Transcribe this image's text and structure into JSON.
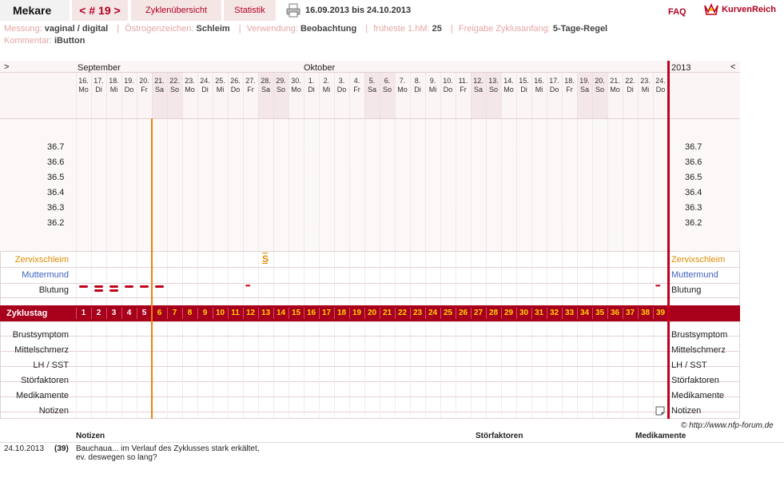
{
  "header": {
    "user": "Mekare",
    "cycle_nav": "< # 19 >",
    "overview": "Zyklenübersicht",
    "stats": "Statistik",
    "date_range": "16.09.2013 bis 24.10.2013",
    "faq": "FAQ",
    "brand": "KurvenReich"
  },
  "info": {
    "messung_label": "Messung:",
    "messung_value": "vaginal / digital",
    "oestrogen_label": "Östrogenzeichen:",
    "oestrogen_value": "Schleim",
    "verwendung_label": "Verwendung:",
    "verwendung_value": "Beobachtung",
    "fhm_label": "früheste 1.hM:",
    "fhm_value": "25",
    "freigabe_label": "Freigabe Zyklusanfang:",
    "freigabe_value": "5-Tage-Regel",
    "kommentar_label": "Kommentar:",
    "kommentar_value": "iButton"
  },
  "chart": {
    "nav_left": ">",
    "nav_right": "<",
    "year": "2013",
    "months": [
      "September",
      "Oktober"
    ],
    "days": [
      {
        "d": "16.",
        "w": "Mo"
      },
      {
        "d": "17.",
        "w": "Di"
      },
      {
        "d": "18.",
        "w": "Mi"
      },
      {
        "d": "19.",
        "w": "Do"
      },
      {
        "d": "20.",
        "w": "Fr"
      },
      {
        "d": "21.",
        "w": "Sa"
      },
      {
        "d": "22.",
        "w": "So"
      },
      {
        "d": "23.",
        "w": "Mo"
      },
      {
        "d": "24.",
        "w": "Di"
      },
      {
        "d": "25.",
        "w": "Mi"
      },
      {
        "d": "26.",
        "w": "Do"
      },
      {
        "d": "27.",
        "w": "Fr"
      },
      {
        "d": "28.",
        "w": "Sa"
      },
      {
        "d": "29.",
        "w": "So"
      },
      {
        "d": "30.",
        "w": "Mo"
      },
      {
        "d": "1.",
        "w": "Di"
      },
      {
        "d": "2.",
        "w": "Mi"
      },
      {
        "d": "3.",
        "w": "Do"
      },
      {
        "d": "4.",
        "w": "Fr"
      },
      {
        "d": "5.",
        "w": "Sa"
      },
      {
        "d": "6.",
        "w": "So"
      },
      {
        "d": "7.",
        "w": "Mo"
      },
      {
        "d": "8.",
        "w": "Di"
      },
      {
        "d": "9.",
        "w": "Mi"
      },
      {
        "d": "10.",
        "w": "Do"
      },
      {
        "d": "11.",
        "w": "Fr"
      },
      {
        "d": "12.",
        "w": "Sa"
      },
      {
        "d": "13.",
        "w": "So"
      },
      {
        "d": "14.",
        "w": "Mo"
      },
      {
        "d": "15.",
        "w": "Di"
      },
      {
        "d": "16.",
        "w": "Mi"
      },
      {
        "d": "17.",
        "w": "Do"
      },
      {
        "d": "18.",
        "w": "Fr"
      },
      {
        "d": "19.",
        "w": "Sa"
      },
      {
        "d": "20.",
        "w": "So"
      },
      {
        "d": "21.",
        "w": "Mo"
      },
      {
        "d": "22.",
        "w": "Di"
      },
      {
        "d": "23.",
        "w": "Mi"
      },
      {
        "d": "24.",
        "w": "Do"
      }
    ],
    "temperatures": [
      "36.7",
      "36.6",
      "36.5",
      "36.4",
      "36.3",
      "36.2"
    ],
    "rows": {
      "zervix": "Zervixschleim",
      "muttermund": "Muttermund",
      "blutung": "Blutung",
      "zyklustag": "Zyklustag",
      "brust": "Brustsymptom",
      "mittel": "Mittelschmerz",
      "lh": "LH / SST",
      "stoer": "Störfaktoren",
      "medi": "Medikamente",
      "notizen": "Notizen"
    },
    "cycle_days": [
      "1",
      "2",
      "3",
      "4",
      "5",
      "6",
      "7",
      "8",
      "9",
      "10",
      "11",
      "12",
      "13",
      "14",
      "15",
      "16",
      "17",
      "18",
      "19",
      "20",
      "21",
      "22",
      "23",
      "24",
      "25",
      "26",
      "27",
      "28",
      "29",
      "30",
      "31",
      "32",
      "33",
      "34",
      "35",
      "36",
      "37",
      "38",
      "39"
    ],
    "zervix_mark": "S",
    "zervix_mark_day": 12,
    "bleeding": [
      {
        "day": 0,
        "level": 1
      },
      {
        "day": 1,
        "level": 2
      },
      {
        "day": 2,
        "level": 2
      },
      {
        "day": 3,
        "level": 1
      },
      {
        "day": 4,
        "level": 1
      },
      {
        "day": 5,
        "level": 1
      }
    ],
    "spotting_days": [
      11,
      38
    ],
    "spot_mark": "•••",
    "colors": {
      "accent": "#b00020",
      "cycle_bar": "#a8001c",
      "weekend": "#f4e6e9",
      "orange": "#f08010",
      "zervix": "#e08a00",
      "mutter": "#4060c0"
    }
  },
  "copyright": "© http://www.nfp-forum.de",
  "notes": {
    "col_notizen": "Notizen",
    "col_stoer": "Störfaktoren",
    "col_medi": "Medikamente",
    "date": "24.10.2013",
    "day": "(39)",
    "text_line1": "Bauchaua... im Verlauf des Zyklusses stark erkältet,",
    "text_line2": "ev. deswegen so lang?"
  }
}
